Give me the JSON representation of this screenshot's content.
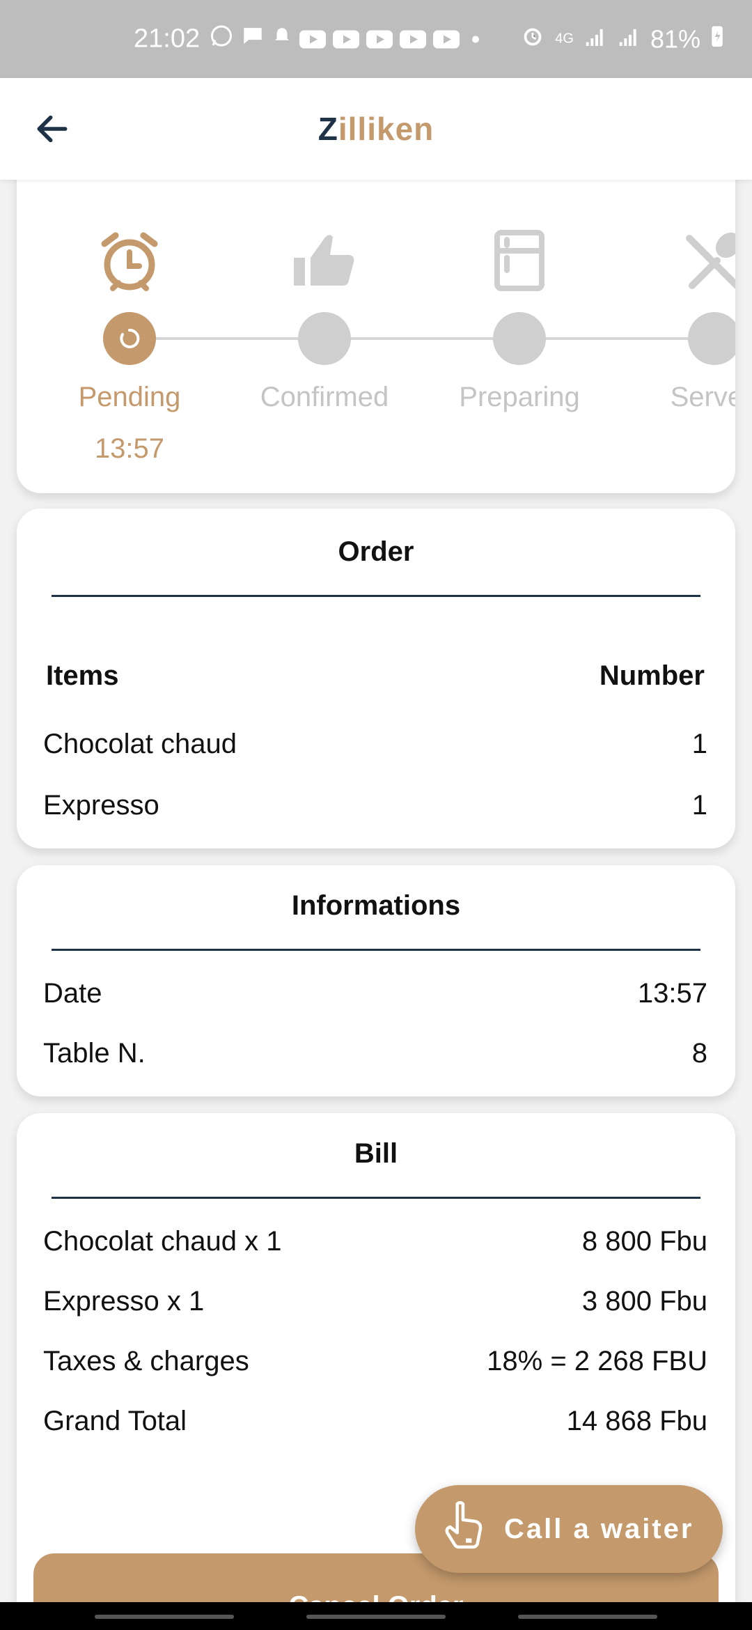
{
  "status_bar": {
    "time": "21:02",
    "battery": "81%",
    "network": "4G"
  },
  "app_bar": {
    "brand_first": "Z",
    "brand_rest": "illiken"
  },
  "progress": {
    "steps": [
      {
        "label": "Pending",
        "sub": "13:57",
        "state": "active",
        "icon": "alarm-clock-icon"
      },
      {
        "label": "Confirmed",
        "state": "inactive",
        "icon": "thumbs-up-icon"
      },
      {
        "label": "Preparing",
        "state": "inactive",
        "icon": "oven-icon"
      },
      {
        "label": "Served",
        "state": "inactive",
        "icon": "fork-spoon-icon"
      }
    ]
  },
  "order": {
    "title": "Order",
    "header_items": "Items",
    "header_number": "Number",
    "rows": [
      {
        "item": "Chocolat chaud",
        "number": "1"
      },
      {
        "item": "Expresso",
        "number": "1"
      }
    ]
  },
  "info": {
    "title": "Informations",
    "rows": [
      {
        "label": "Date",
        "value": "13:57"
      },
      {
        "label": "Table N.",
        "value": "8"
      }
    ]
  },
  "bill": {
    "title": "Bill",
    "rows": [
      {
        "label": "Chocolat chaud x 1",
        "value": "8 800 Fbu"
      },
      {
        "label": "Expresso x 1",
        "value": "3 800 Fbu"
      },
      {
        "label": "Taxes & charges",
        "value": "18% = 2 268 FBU"
      },
      {
        "label": "Grand Total",
        "value": "14 868 Fbu"
      }
    ]
  },
  "actions": {
    "cancel_label": "Cancel Order",
    "call_waiter_label": "Call a waiter"
  },
  "colors": {
    "accent": "#c49a6c",
    "navy": "#1d3147",
    "inactive": "#cfcfcf"
  }
}
